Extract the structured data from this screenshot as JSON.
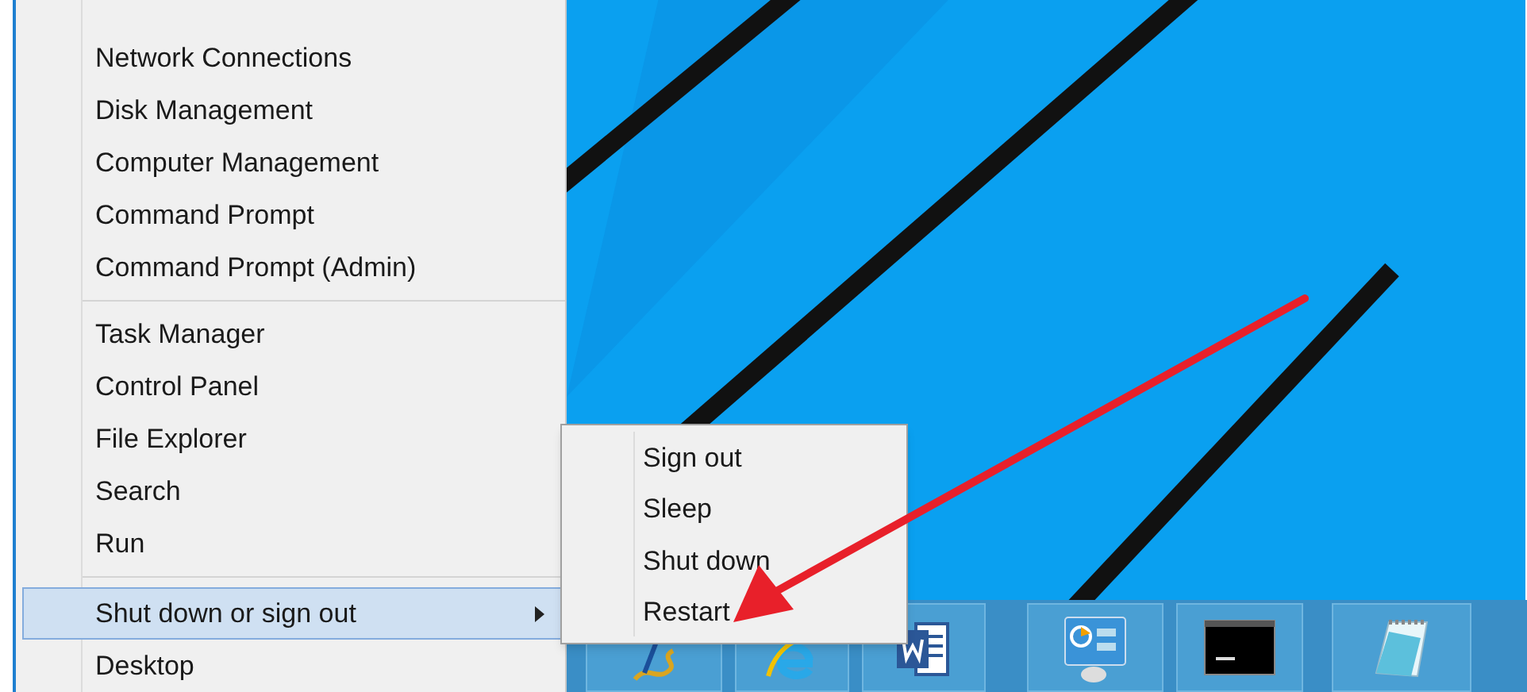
{
  "menu": {
    "sections": [
      {
        "items": [
          {
            "label": "Network Connections",
            "selected": false,
            "has_submenu": false
          },
          {
            "label": "Disk Management",
            "selected": false,
            "has_submenu": false
          },
          {
            "label": "Computer Management",
            "selected": false,
            "has_submenu": false
          },
          {
            "label": "Command Prompt",
            "selected": false,
            "has_submenu": false
          },
          {
            "label": "Command Prompt (Admin)",
            "selected": false,
            "has_submenu": false
          }
        ]
      },
      {
        "items": [
          {
            "label": "Task Manager",
            "selected": false,
            "has_submenu": false
          },
          {
            "label": "Control Panel",
            "selected": false,
            "has_submenu": false
          },
          {
            "label": "File Explorer",
            "selected": false,
            "has_submenu": false
          },
          {
            "label": "Search",
            "selected": false,
            "has_submenu": false
          },
          {
            "label": "Run",
            "selected": false,
            "has_submenu": false
          }
        ]
      },
      {
        "items": [
          {
            "label": "Shut down or sign out",
            "selected": true,
            "has_submenu": true
          },
          {
            "label": "Desktop",
            "selected": false,
            "has_submenu": false
          }
        ]
      }
    ]
  },
  "submenu": {
    "items": [
      {
        "label": "Sign out"
      },
      {
        "label": "Sleep"
      },
      {
        "label": "Shut down"
      },
      {
        "label": "Restart"
      }
    ]
  }
}
